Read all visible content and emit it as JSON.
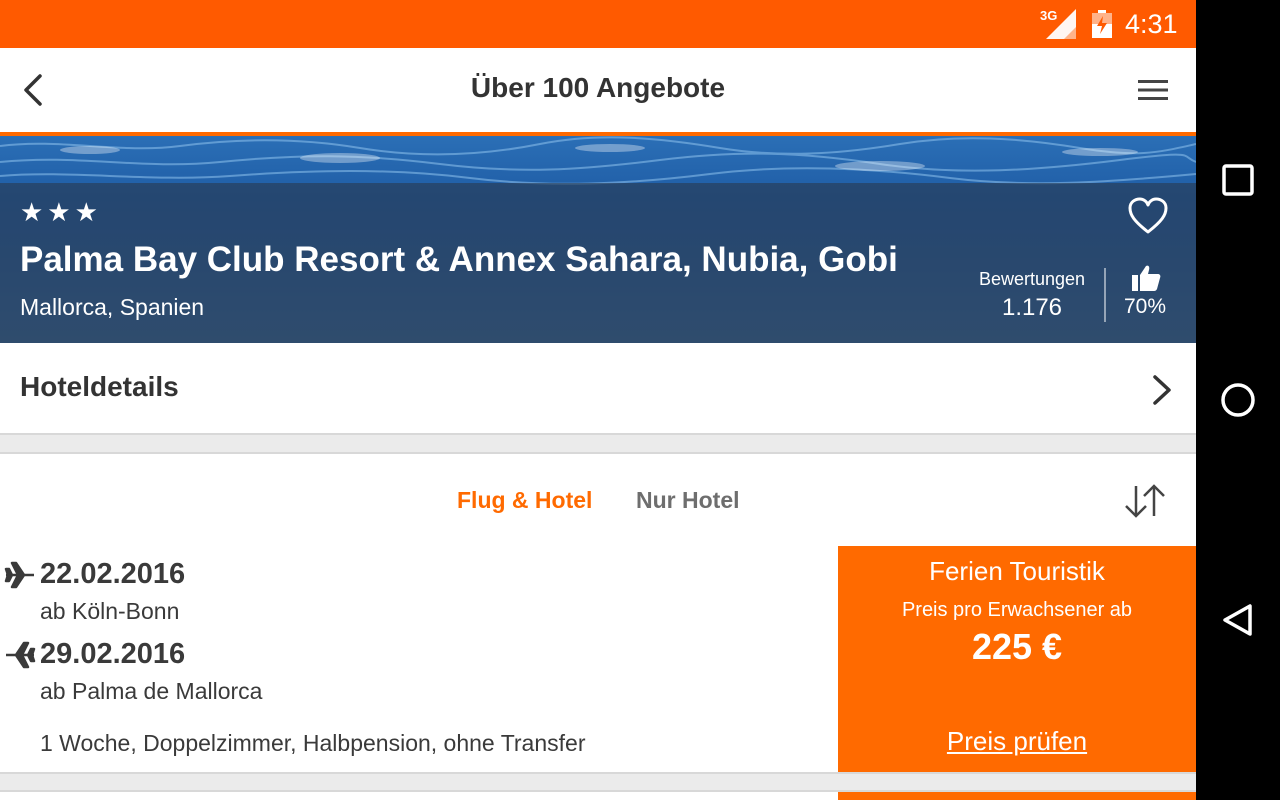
{
  "status_bar": {
    "network": "3G",
    "time": "4:31"
  },
  "toolbar": {
    "title": "Über 100 Angebote"
  },
  "hotel": {
    "stars": "★★★",
    "star_count": 3,
    "name": "Palma Bay Club Resort & Annex Sahara, Nubia, Gobi",
    "location": "Mallorca, Spanien",
    "ratings_label": "Bewertungen",
    "ratings_count": "1.176",
    "recommend_percent": "70%"
  },
  "details": {
    "label": "Hoteldetails"
  },
  "tabs": [
    {
      "label": "Flug & Hotel",
      "active": true
    },
    {
      "label": "Nur Hotel",
      "active": false
    }
  ],
  "offer": {
    "outbound": {
      "date": "22.02.2016",
      "from": "ab Köln-Bonn"
    },
    "return": {
      "date": "29.02.2016",
      "from": "ab Palma de Mallorca"
    },
    "summary": "1 Woche, Doppelzimmer, Halbpension, ohne Transfer",
    "operator": "Ferien Touristik",
    "price_caption": "Preis pro Erwachsener ab",
    "price": "225 €",
    "check_label": "Preis prüfen"
  },
  "colors": {
    "accent": "#ff6a00",
    "status_bar": "#ff5a00"
  },
  "icons": [
    "back-arrow-icon",
    "menu-icon",
    "heart-icon",
    "thumbs-up-icon",
    "chevron-right-icon",
    "sort-icon",
    "plane-icon",
    "square-icon",
    "circle-icon",
    "triangle-back-icon"
  ]
}
